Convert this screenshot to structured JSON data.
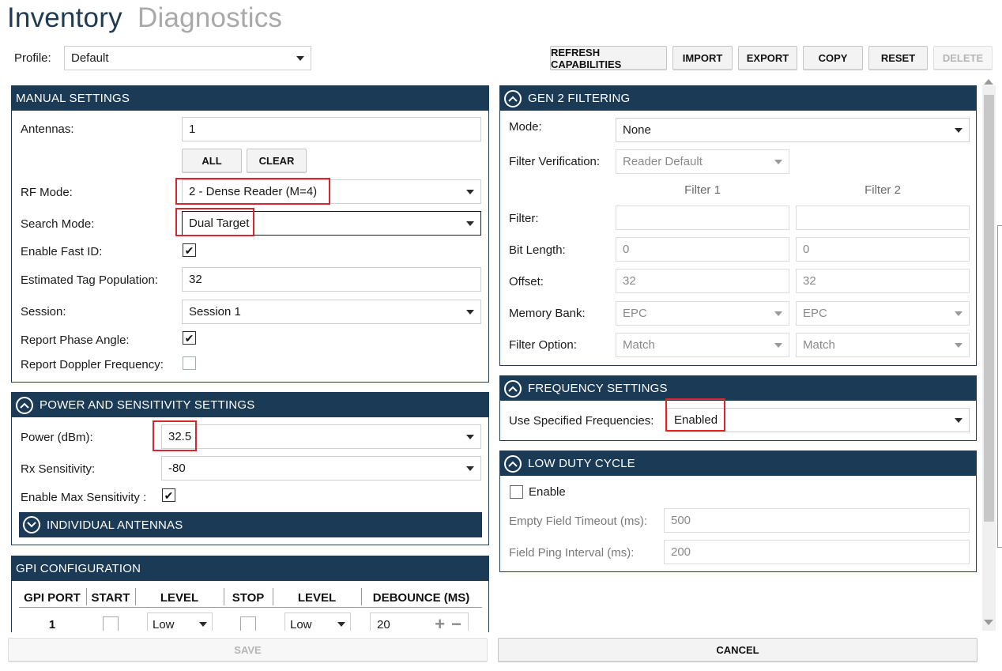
{
  "header": {
    "tab_active": "Inventory",
    "tab_inactive": "Diagnostics"
  },
  "profile": {
    "label": "Profile:",
    "value": "Default"
  },
  "toolbar": {
    "refresh": "REFRESH CAPABILITIES",
    "import": "IMPORT",
    "export": "EXPORT",
    "copy": "COPY",
    "reset": "RESET",
    "delete": "DELETE"
  },
  "manual": {
    "title": "MANUAL SETTINGS",
    "antennas_label": "Antennas:",
    "antennas_value": "1",
    "all_button": "ALL",
    "clear_button": "CLEAR",
    "rf_mode_label": "RF Mode:",
    "rf_mode_value": "2 - Dense Reader (M=4)",
    "search_mode_label": "Search Mode:",
    "search_mode_value": "Dual Target",
    "fast_id_label": "Enable Fast ID:",
    "fast_id_checked": true,
    "tag_pop_label": "Estimated Tag Population:",
    "tag_pop_value": "32",
    "session_label": "Session:",
    "session_value": "Session 1",
    "phase_label": "Report Phase Angle:",
    "phase_checked": true,
    "doppler_label": "Report Doppler Frequency:",
    "doppler_checked": false
  },
  "power": {
    "title": "POWER AND SENSITIVITY SETTINGS",
    "power_label": "Power (dBm):",
    "power_value": "32.5",
    "rx_label": "Rx Sensitivity:",
    "rx_value": "-80",
    "max_sens_label": "Enable Max Sensitivity :",
    "max_sens_checked": true,
    "individual_title": "INDIVIDUAL ANTENNAS"
  },
  "gpi": {
    "title": "GPI CONFIGURATION",
    "headers": [
      "GPI PORT",
      "START",
      "LEVEL",
      "STOP",
      "LEVEL",
      "DEBOUNCE (MS)"
    ],
    "rows": [
      {
        "port": "1",
        "start_level": "Low",
        "stop_level": "Low",
        "debounce": "20",
        "plus": "+",
        "minus": "−"
      }
    ]
  },
  "gen2": {
    "title": "GEN 2 FILTERING",
    "mode_label": "Mode:",
    "mode_value": "None",
    "verification_label": "Filter Verification:",
    "verification_value": "Reader Default",
    "filter1_header": "Filter 1",
    "filter2_header": "Filter 2",
    "filter_label": "Filter:",
    "filter1_value": "",
    "filter2_value": "",
    "bitlen_label": "Bit Length:",
    "bitlen1": "0",
    "bitlen2": "0",
    "offset_label": "Offset:",
    "offset1": "32",
    "offset2": "32",
    "membank_label": "Memory Bank:",
    "membank1": "EPC",
    "membank2": "EPC",
    "option_label": "Filter Option:",
    "option1": "Match",
    "option2": "Match"
  },
  "frequency": {
    "title": "FREQUENCY SETTINGS",
    "use_label": "Use Specified Frequencies:",
    "use_value": "Enabled"
  },
  "duty": {
    "title": "LOW DUTY CYCLE",
    "enable_label": "Enable",
    "enable_checked": false,
    "timeout_label": "Empty Field Timeout (ms):",
    "timeout_value": "500",
    "ping_label": "Field Ping Interval (ms):",
    "ping_value": "200"
  },
  "footer": {
    "save": "SAVE",
    "cancel": "CANCEL"
  },
  "colors": {
    "header_bg": "#1a3a55",
    "title_active": "#1f3a52",
    "title_inactive": "#a9a9a9",
    "highlight": "#d9262c"
  }
}
